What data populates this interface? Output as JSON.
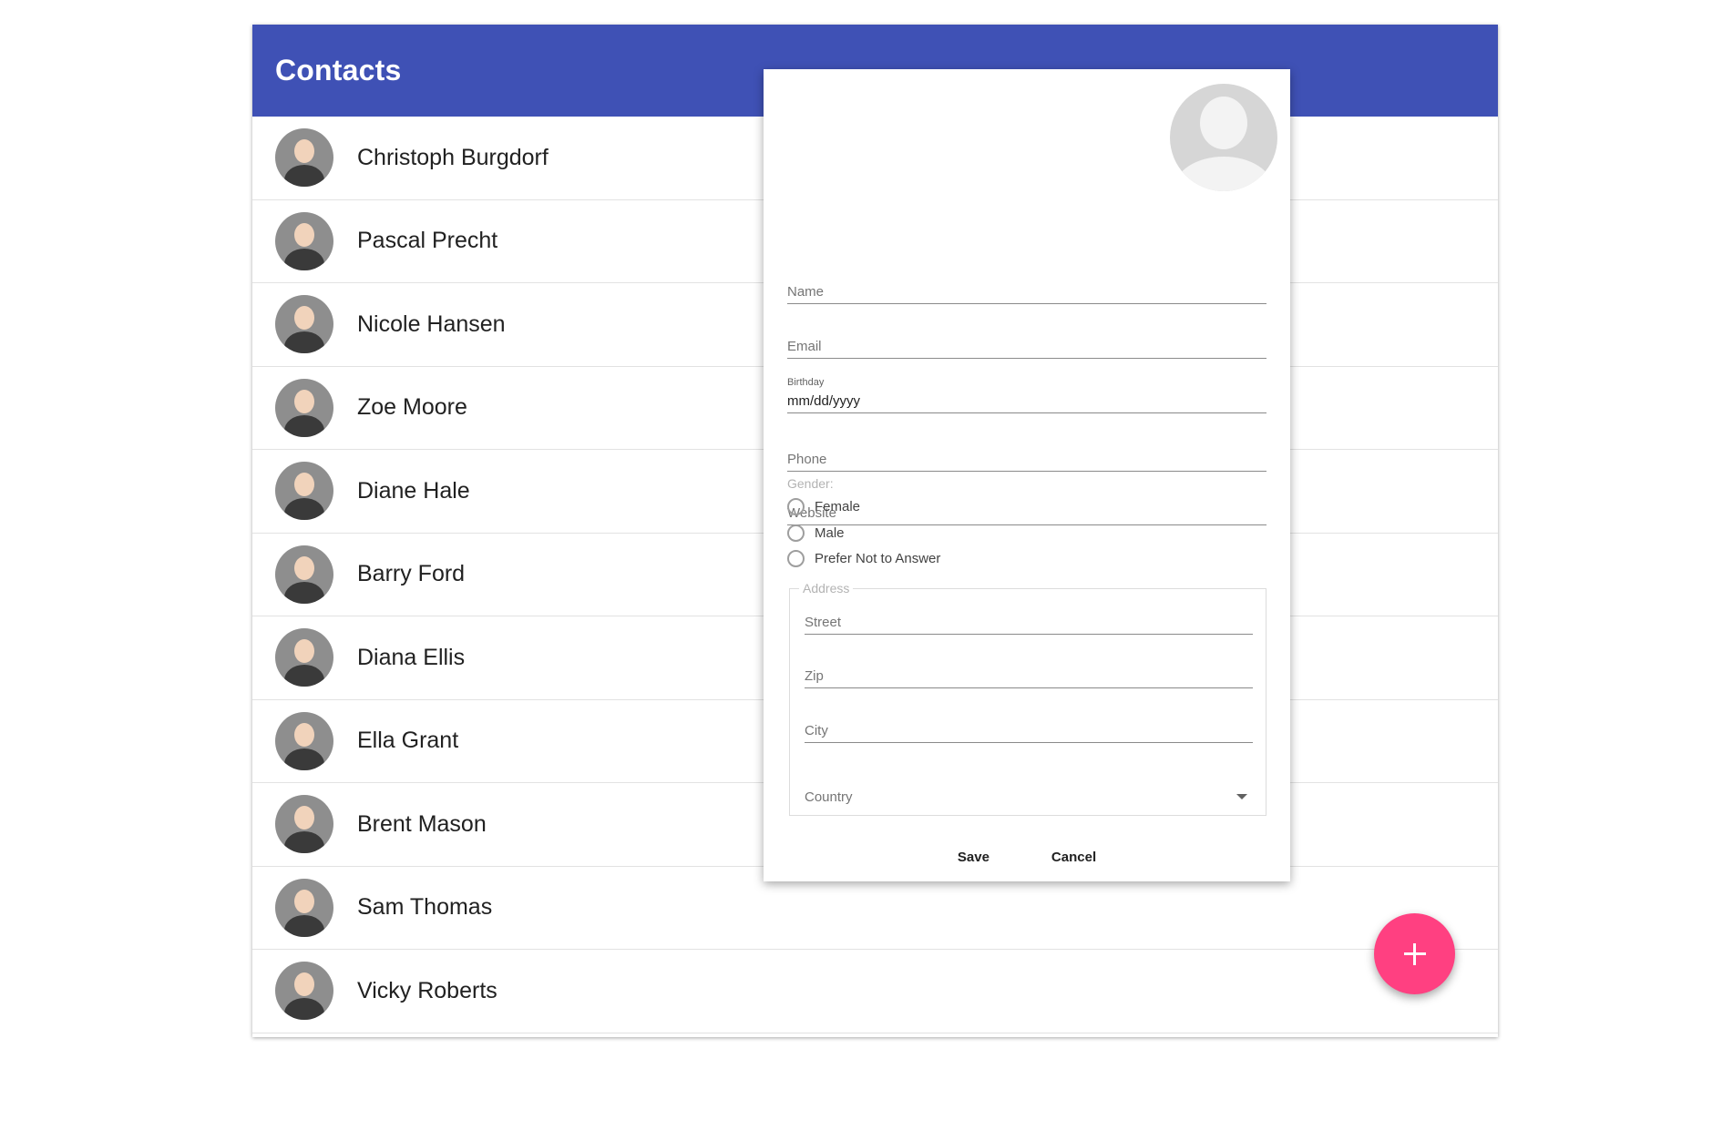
{
  "toolbar": {
    "title": "Contacts"
  },
  "contacts": [
    {
      "name": "Christoph Burgdorf"
    },
    {
      "name": "Pascal Precht"
    },
    {
      "name": "Nicole Hansen"
    },
    {
      "name": "Zoe Moore"
    },
    {
      "name": "Diane Hale"
    },
    {
      "name": "Barry Ford"
    },
    {
      "name": "Diana Ellis"
    },
    {
      "name": "Ella Grant"
    },
    {
      "name": "Brent Mason"
    },
    {
      "name": "Sam Thomas"
    },
    {
      "name": "Vicky Roberts"
    }
  ],
  "form": {
    "name_placeholder": "Name",
    "email_placeholder": "Email",
    "birthday_label": "Birthday",
    "birthday_value": "mm/dd/yyyy",
    "phone_placeholder": "Phone",
    "website_placeholder": "Website",
    "gender_label": "Gender:",
    "gender_options": [
      "Female",
      "Male",
      "Prefer Not to Answer"
    ],
    "address_legend": "Address",
    "street_placeholder": "Street",
    "zip_placeholder": "Zip",
    "city_placeholder": "City",
    "country_placeholder": "Country",
    "save_label": "Save",
    "cancel_label": "Cancel"
  },
  "colors": {
    "primary": "#3f51b5",
    "accent": "#ff4081"
  },
  "icons": {
    "fab": "plus-icon",
    "default_avatar": "person-avatar-icon",
    "select_caret": "caret-down-icon"
  }
}
